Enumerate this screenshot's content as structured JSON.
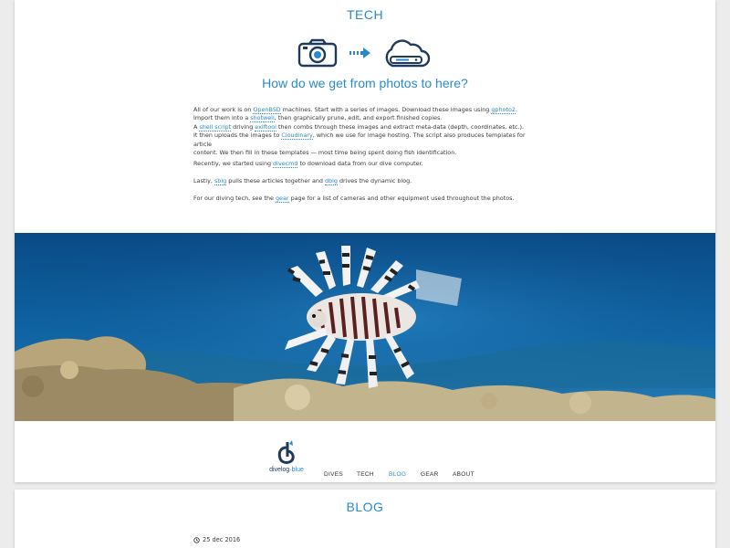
{
  "colors": {
    "accent": "#2a8ac9",
    "dark": "#1f3a5a",
    "page_background": "#ececec",
    "card_background": "#ffffff"
  },
  "tech": {
    "title": "TECH",
    "icons": [
      "camera-icon",
      "arrow-right-icon",
      "cloud-icon"
    ],
    "heading": "How do we get from photos to here?",
    "p1_lines": [
      {
        "segments": [
          {
            "text": "All of our work is on "
          },
          {
            "text": "OpenBSD",
            "link": true
          },
          {
            "text": " machines. Start with a series of images. Download these images using "
          },
          {
            "text": "gphoto2",
            "link": true
          },
          {
            "text": "."
          }
        ]
      },
      {
        "segments": [
          {
            "text": "Import them into a "
          },
          {
            "text": "shotwell",
            "link": true
          },
          {
            "text": ", then graphically prune, edit, and export finished copies."
          }
        ]
      },
      {
        "segments": [
          {
            "text": "A "
          },
          {
            "text": "shell script",
            "link": true
          },
          {
            "text": " driving "
          },
          {
            "text": "exiftool",
            "link": true
          },
          {
            "text": " then combs through these images and extract meta-data (depth, coordinates, etc.)."
          }
        ]
      },
      {
        "segments": [
          {
            "text": "It then uploads the images to "
          },
          {
            "text": "Cloudinary",
            "link": true
          },
          {
            "text": ", which we use for image hosting. The script also produces templates for article"
          }
        ]
      },
      {
        "segments": [
          {
            "text": "content. We then fill in these templates — most time being spent doing fish identification."
          }
        ]
      }
    ],
    "p2": {
      "before": "Recently, we started using ",
      "link": "divecmd",
      "after": " to download data from our dive computer."
    },
    "p3": {
      "before": "Lastly, ",
      "link1": "sblg",
      "middle": " pulls these articles together and ",
      "link2": "dblg",
      "after": " drives the dynamic blog."
    },
    "p4": {
      "before": "For our diving tech, see the ",
      "link": "gear",
      "after": " page for a list of cameras and other equipment used throughout the photos."
    }
  },
  "photo": {
    "subject": "lionfish over coral reef"
  },
  "nav": {
    "logo_text_1": "divelog",
    "logo_text_2": "·blue",
    "items": [
      "DIVES",
      "TECH",
      "BLOG",
      "GEAR",
      "ABOUT"
    ],
    "active": "BLOG"
  },
  "blog": {
    "title": "BLOG",
    "date": "25 dec 2016"
  }
}
